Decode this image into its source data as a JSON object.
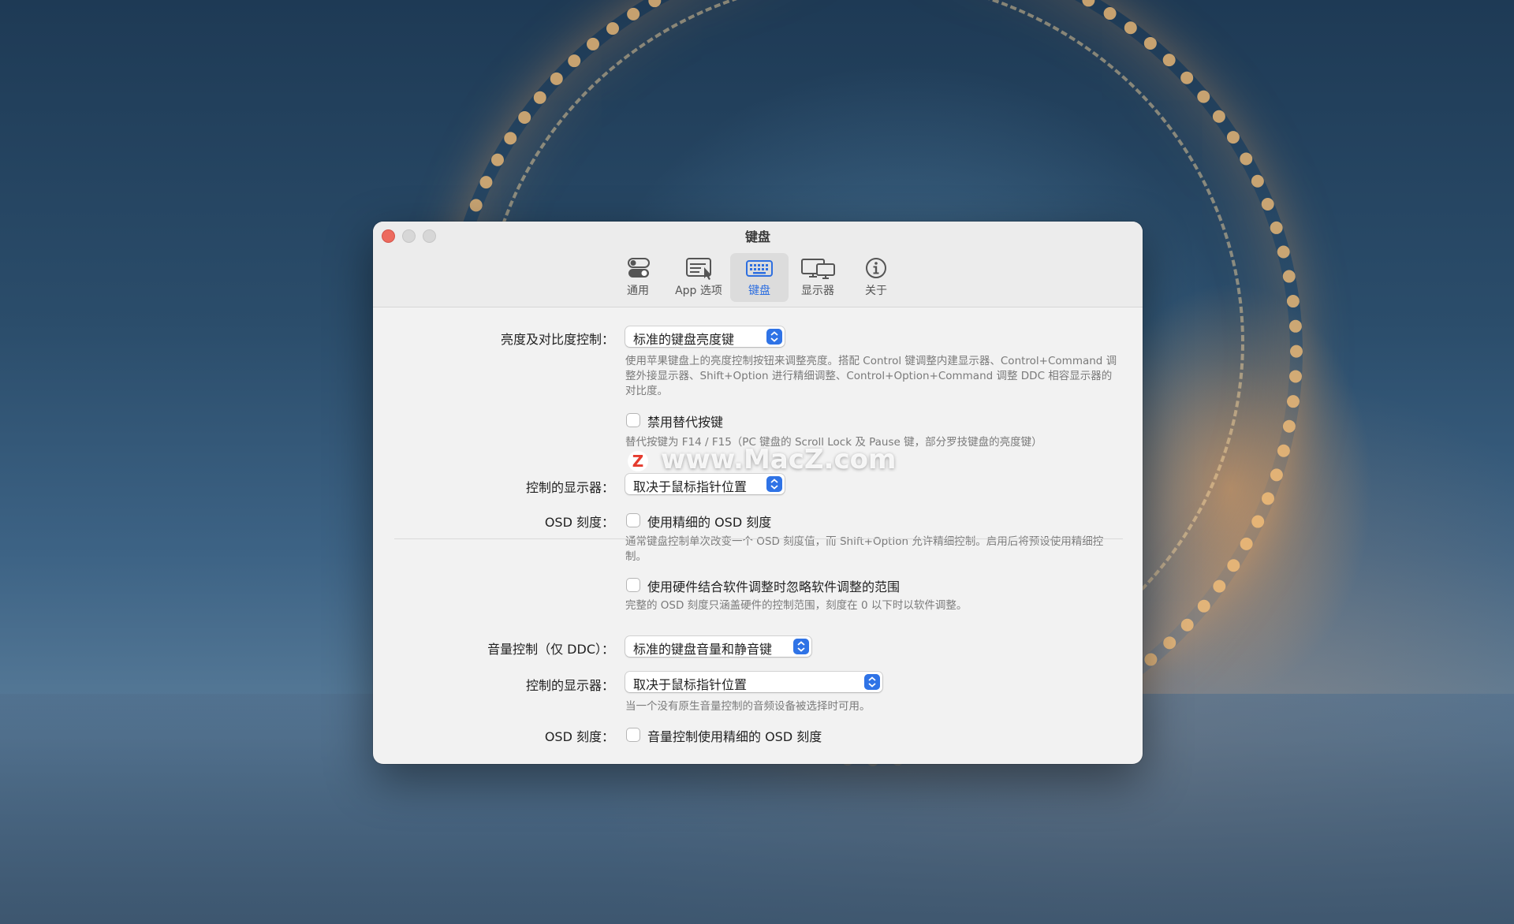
{
  "window": {
    "title": "键盘"
  },
  "tabs": [
    {
      "label": "通用",
      "icon": "toggle-switches-icon"
    },
    {
      "label": "App 选项",
      "icon": "app-options-icon"
    },
    {
      "label": "键盘",
      "icon": "keyboard-icon",
      "active": true
    },
    {
      "label": "显示器",
      "icon": "displays-icon"
    },
    {
      "label": "关于",
      "icon": "info-icon"
    }
  ],
  "brightness": {
    "label": "亮度及对比度控制：",
    "popup_value": "标准的键盘亮度键",
    "description": "使用苹果键盘上的亮度控制按钮来调整亮度。搭配 Control 键调整内建显示器、Control+Command 调整外接显示器、Shift+Option 进行精细调整、Control+Option+Command 调整 DDC 相容显示器的对比度。",
    "disable_alt_keys_label": "禁用替代按键",
    "disable_alt_keys_checked": false,
    "alt_keys_description": "替代按键为 F14 / F15（PC 键盘的 Scroll Lock 及 Pause 键，部分罗技键盘的亮度键）"
  },
  "brightness_display": {
    "label": "控制的显示器：",
    "popup_value": "取决于鼠标指针位置"
  },
  "osd": {
    "label": "OSD 刻度：",
    "fine_osd_label": "使用精细的 OSD 刻度",
    "fine_osd_checked": false,
    "fine_osd_description": "通常键盘控制单次改变一个 OSD 刻度值，而 Shift+Option 允许精细控制。启用后将预设使用精细控制。",
    "hw_sw_label": "使用硬件结合软件调整时忽略软件调整的范围",
    "hw_sw_checked": false,
    "hw_sw_description": "完整的 OSD 刻度只涵盖硬件的控制范围，刻度在 0 以下时以软件调整。"
  },
  "volume": {
    "label": "音量控制（仅 DDC）：",
    "popup_value": "标准的键盘音量和静音键"
  },
  "volume_display": {
    "label": "控制的显示器：",
    "popup_value": "取决于鼠标指针位置",
    "description": "当一个没有原生音量控制的音频设备被选择时可用。"
  },
  "volume_osd": {
    "label": "OSD 刻度：",
    "fine_osd_label": "音量控制使用精细的 OSD 刻度",
    "fine_osd_checked": false
  },
  "watermark": {
    "logo": "Z",
    "text": "www.MacZ.com"
  },
  "colors": {
    "accent": "#2f73e6",
    "close": "#ed6a5e"
  }
}
